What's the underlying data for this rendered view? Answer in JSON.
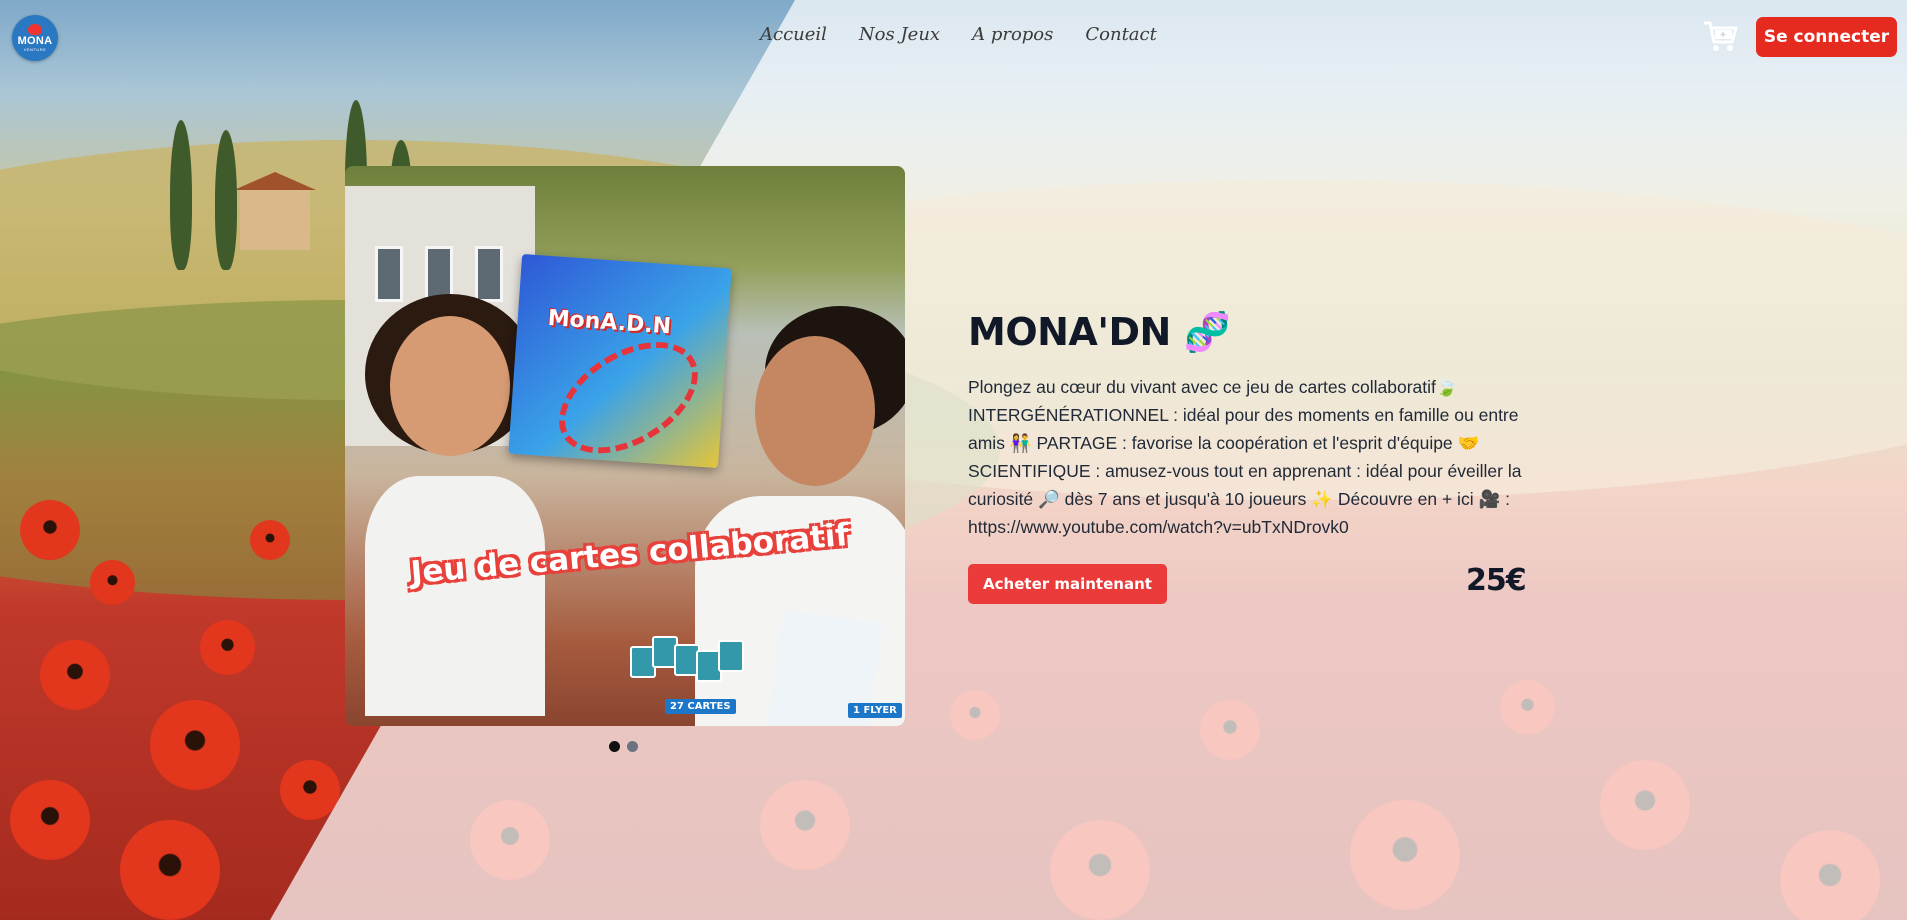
{
  "brand": {
    "logo_text": "MONA",
    "logo_sub": "VENTURE"
  },
  "nav": {
    "items": [
      "Accueil",
      "Nos Jeux",
      "A propos",
      "Contact"
    ]
  },
  "header": {
    "cart_icon": "shopping-cart-icon",
    "login_label": "Se connecter"
  },
  "product": {
    "title": "MONA'DN 🧬",
    "description": "Plongez au cœur du vivant avec ce jeu de cartes collaboratif🍃 INTERGÉNÉRATIONNEL : idéal pour des moments en famille ou entre amis 👫 PARTAGE : favorise la coopération et l'esprit d'équipe 🤝 SCIENTIFIQUE : amusez-vous tout en apprenant : idéal pour éveiller la curiosité 🔎 dès 7 ans et jusqu'à 10 joueurs ✨ Découvre en + ici 🎥 : https://www.youtube.com/watch?v=ubTxNDrovk0",
    "buy_label": "Acheter maintenant",
    "price": "25€",
    "image": {
      "box_title": "MonA.D.N",
      "caption": "Jeu de cartes collaboratif",
      "cards_label": "27 CARTES",
      "flyer_label": "1 FLYER"
    },
    "carousel": {
      "count": 2,
      "active": 1
    }
  },
  "colors": {
    "accent": "#e52a20",
    "buy": "#ea3a3a",
    "text": "#111827"
  }
}
